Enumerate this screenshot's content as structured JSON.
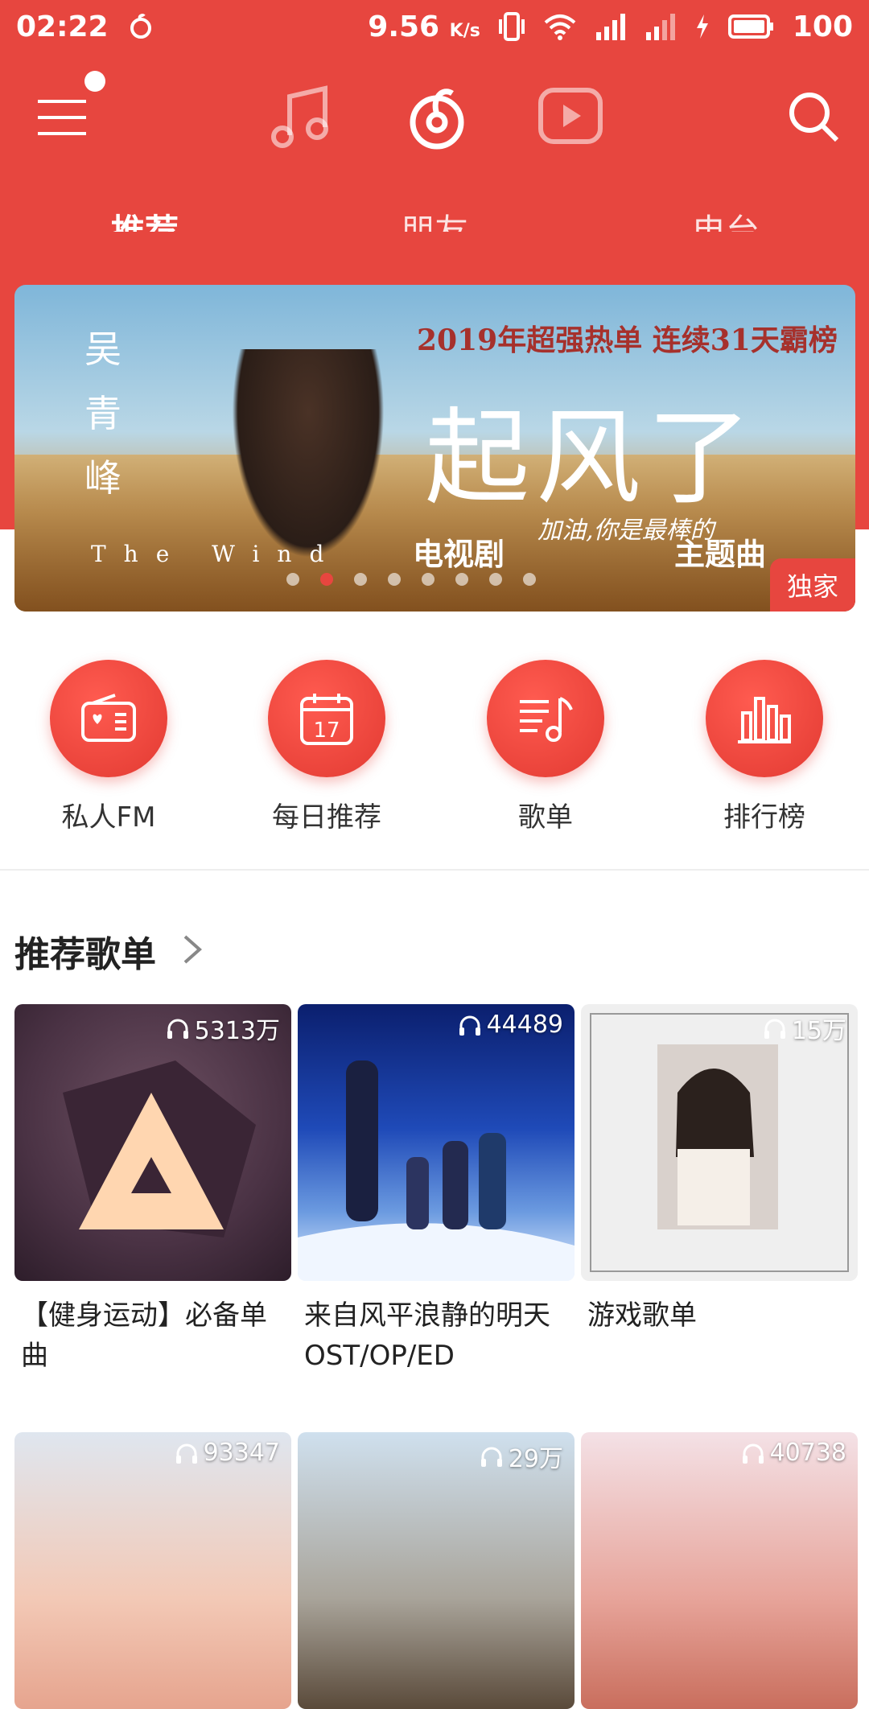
{
  "status_bar": {
    "time": "02:22",
    "speed": "9.56",
    "speed_unit": "K/s",
    "battery": "100"
  },
  "header": {
    "tabs": [
      {
        "label": "推荐",
        "active": true
      },
      {
        "label": "朋友",
        "active": false
      },
      {
        "label": "电台",
        "active": false
      }
    ],
    "accent_color": "#e7463f"
  },
  "banner": {
    "vertical_text": "吴青峰",
    "headline": "2019年超强热单 连续31天霸榜",
    "title": "起风了",
    "subtitle_left": "电视剧",
    "subtitle_script": "加油,你是最棒的",
    "subtitle_right": "主题曲",
    "english": "The Wind",
    "badge": "独家",
    "active_dot": 1,
    "dot_count": 9
  },
  "quick_entries": [
    {
      "label": "私人FM",
      "icon": "radio-icon"
    },
    {
      "label": "每日推荐",
      "icon": "calendar-icon",
      "day": "17"
    },
    {
      "label": "歌单",
      "icon": "playlist-icon"
    },
    {
      "label": "排行榜",
      "icon": "chart-bars-icon"
    }
  ],
  "recommend": {
    "title": "推荐歌单",
    "playlists": [
      {
        "count": "5313万",
        "title": "【健身运动】必备单曲"
      },
      {
        "count": "44489",
        "title": "来自风平浪静的明天OST/OP/ED"
      },
      {
        "count": "15万",
        "title": "游戏歌单"
      },
      {
        "count": "93347",
        "title": ""
      },
      {
        "count": "29万",
        "title": ""
      },
      {
        "count": "40738",
        "title": ""
      }
    ]
  }
}
